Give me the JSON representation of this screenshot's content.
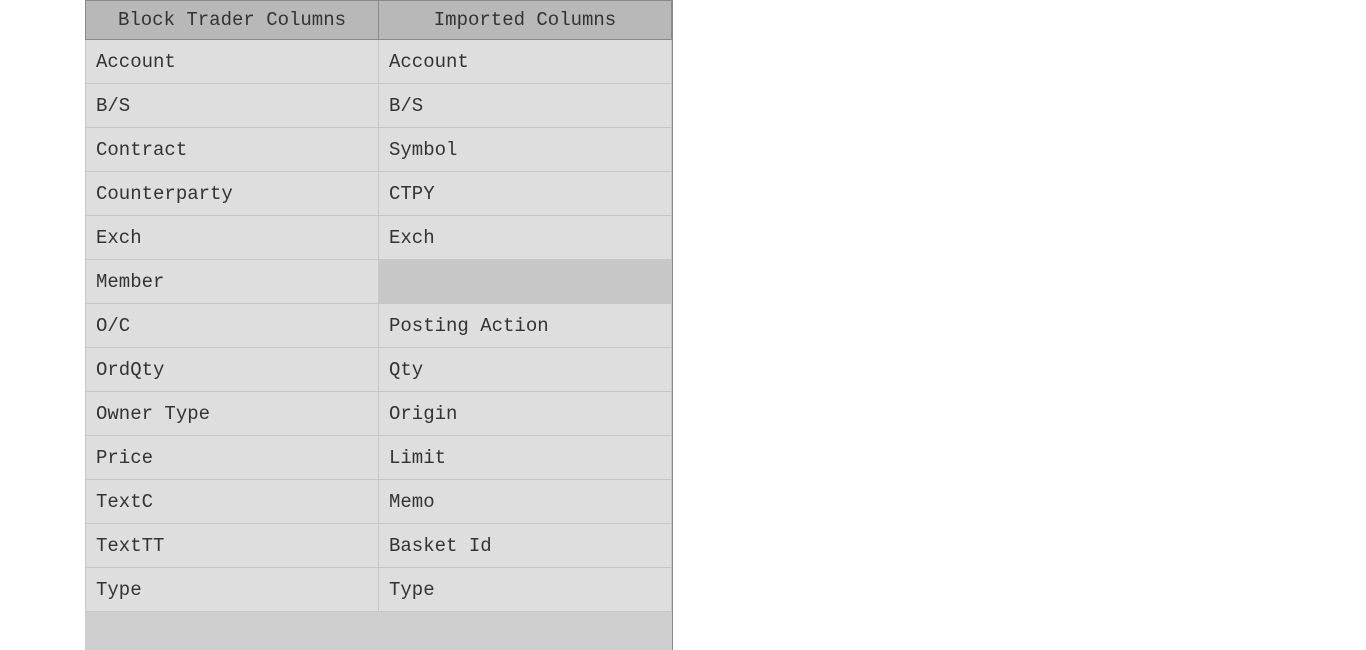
{
  "table": {
    "headers": [
      "Block Trader Columns",
      "Imported Columns"
    ],
    "rows": [
      {
        "left": "Account",
        "right": "Account",
        "selected": false
      },
      {
        "left": "B/S",
        "right": "B/S",
        "selected": false
      },
      {
        "left": "Contract",
        "right": "Symbol",
        "selected": false
      },
      {
        "left": "Counterparty",
        "right": "CTPY",
        "selected": false
      },
      {
        "left": "Exch",
        "right": "Exch",
        "selected": false
      },
      {
        "left": "Member",
        "right": "",
        "selected": true
      },
      {
        "left": "O/C",
        "right": "Posting Action",
        "selected": false
      },
      {
        "left": "OrdQty",
        "right": "Qty",
        "selected": false
      },
      {
        "left": "Owner Type",
        "right": "Origin",
        "selected": false
      },
      {
        "left": "Price",
        "right": "Limit",
        "selected": false
      },
      {
        "left": "TextC",
        "right": "Memo",
        "selected": false
      },
      {
        "left": "TextTT",
        "right": "Basket Id",
        "selected": false
      },
      {
        "left": "Type",
        "right": "Type",
        "selected": false
      }
    ]
  }
}
